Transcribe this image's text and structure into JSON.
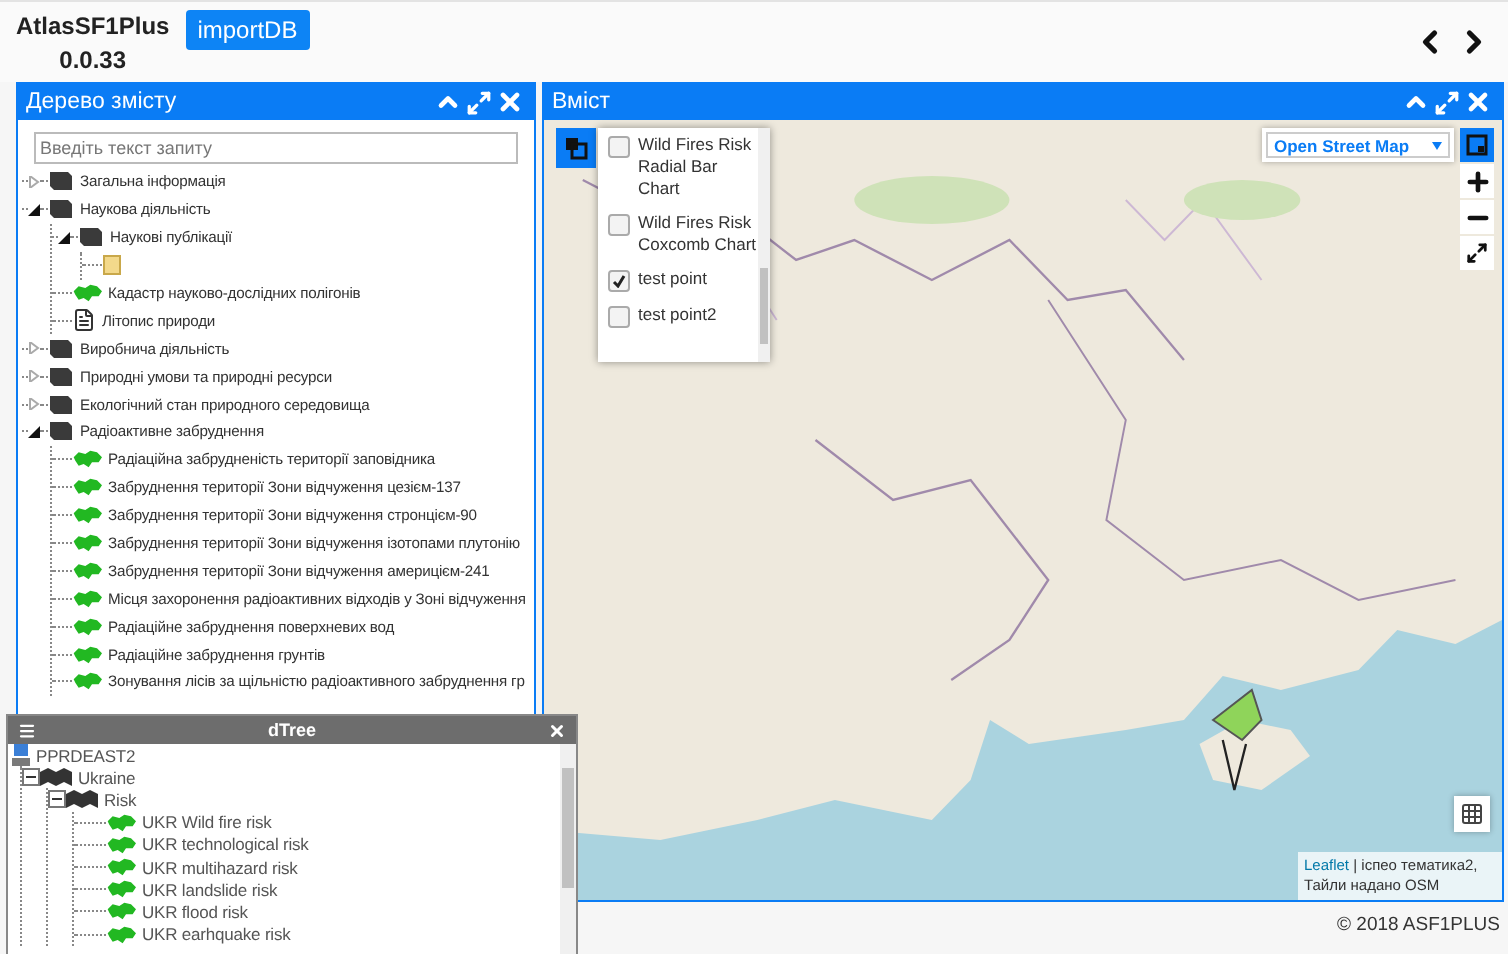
{
  "header": {
    "title": "AtlasSF1Plus",
    "version": "0.0.33",
    "button": "importDB"
  },
  "left_panel": {
    "title": "Дерево змісту",
    "search": {
      "placeholder": "Введіть текст запиту"
    },
    "tree": [
      {
        "label": "Загальна інформація",
        "kind": "book",
        "expanded": false
      },
      {
        "label": "Наукова діяльність",
        "kind": "book",
        "expanded": true,
        "children": [
          {
            "label": "Наукові публікації",
            "kind": "book",
            "expanded": true,
            "children": [
              {
                "kind": "folder"
              }
            ]
          },
          {
            "label": "Кадастр науково-дослідних полігонів",
            "kind": "region"
          },
          {
            "label": "Літопис природи",
            "kind": "document"
          }
        ]
      },
      {
        "label": "Виробнича діяльність",
        "kind": "book",
        "expanded": false
      },
      {
        "label": "Природні умови та природні ресурси",
        "kind": "book",
        "expanded": false
      },
      {
        "label": "Екологічний стан природного середовища",
        "kind": "book",
        "expanded": false
      },
      {
        "label": "Радіоактивне забруднення",
        "kind": "book",
        "expanded": true,
        "children": [
          {
            "label": "Радіаційна забрудненість території заповідника",
            "kind": "region"
          },
          {
            "label": "Забруднення території Зони відчуження цезієм-137",
            "kind": "region"
          },
          {
            "label": "Забруднення території Зони відчуження стронцієм-90",
            "kind": "region"
          },
          {
            "label": "Забруднення території Зони відчуження ізотопами плутонію",
            "kind": "region"
          },
          {
            "label": "Забруднення території Зони відчуження америцієм-241",
            "kind": "region"
          },
          {
            "label": "Місця захоронення радіоактивних відходів у Зоні відчуження",
            "kind": "region"
          },
          {
            "label": "Радіаційне забруднення поверхневих вод",
            "kind": "region"
          },
          {
            "label": "Радіаційне забруднення грунтів",
            "kind": "region"
          },
          {
            "label": "Зонування лісів за щільністю радіоактивного забруднення гр",
            "kind": "region"
          }
        ]
      }
    ]
  },
  "content_panel": {
    "title": "Вміст",
    "layers": [
      {
        "label": "Wild Fires Risk Radial Bar Chart",
        "checked": false
      },
      {
        "label": "Wild Fires Risk Coxcomb Chart",
        "checked": false
      },
      {
        "label": "test point",
        "checked": true
      },
      {
        "label": "test point2",
        "checked": false
      }
    ],
    "base_layer": "Open Street Map",
    "attribution": {
      "link": "Leaflet",
      "text": "| іспео тематика2, Тайли надано OSM"
    }
  },
  "footer": "© 2018 ASF1PLUS",
  "dtree": {
    "title": "dTree",
    "tree": [
      {
        "label": "PPRDEAST2",
        "kind": "server",
        "children": [
          {
            "label": "Ukraine",
            "kind": "books",
            "expanded": true,
            "children": [
              {
                "label": "Risk",
                "kind": "books",
                "expanded": true,
                "children": [
                  {
                    "label": "UKR Wild fire risk",
                    "kind": "region"
                  },
                  {
                    "label": "UKR technological risk",
                    "kind": "region"
                  },
                  {
                    "label": "UKR multihazard risk",
                    "kind": "region"
                  },
                  {
                    "label": "UKR landslide risk",
                    "kind": "region"
                  },
                  {
                    "label": "UKR flood risk",
                    "kind": "region"
                  },
                  {
                    "label": "UKR earhquake risk",
                    "kind": "region"
                  }
                ]
              }
            ]
          }
        ]
      }
    ]
  }
}
